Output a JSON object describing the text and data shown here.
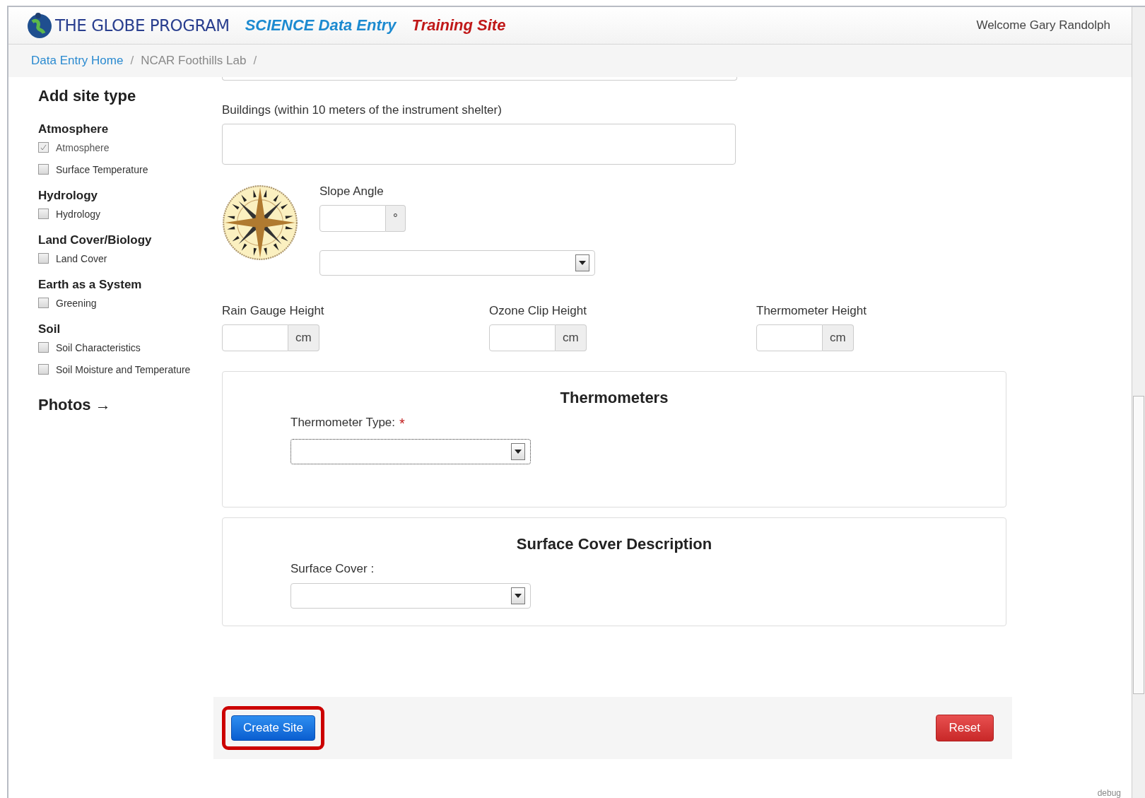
{
  "header": {
    "logo_text": "THE GLOBE PROGRAM",
    "app_title": "SCIENCE Data Entry",
    "site_label": "Training Site",
    "welcome": "Welcome Gary Randolph"
  },
  "breadcrumbs": [
    {
      "label": "Data Entry Home",
      "kind": "link",
      "separator": "/"
    },
    {
      "label": "NCAR Foothills Lab",
      "kind": "current",
      "separator": "/"
    }
  ],
  "sidebar": {
    "title": "Add site type",
    "groups": [
      {
        "heading": "Atmosphere",
        "items": [
          {
            "label": "Atmosphere",
            "checked": true,
            "disabled": true
          },
          {
            "label": "Surface Temperature",
            "checked": false,
            "disabled": false
          }
        ]
      },
      {
        "heading": "Hydrology",
        "items": [
          {
            "label": "Hydrology",
            "checked": false,
            "disabled": false
          }
        ]
      },
      {
        "heading": "Land Cover/Biology",
        "items": [
          {
            "label": "Land Cover",
            "checked": false,
            "disabled": false
          }
        ]
      },
      {
        "heading": "Earth as a System",
        "items": [
          {
            "label": "Greening",
            "checked": false,
            "disabled": false
          }
        ]
      },
      {
        "heading": "Soil",
        "items": [
          {
            "label": "Soil Characteristics",
            "checked": false,
            "disabled": false
          },
          {
            "label": "Soil Moisture and Temperature",
            "checked": false,
            "disabled": false
          }
        ]
      }
    ],
    "photos_link": "Photos →"
  },
  "form": {
    "buildings_label": "Buildings (within 10 meters of the instrument shelter)",
    "slope_label": "Slope Angle",
    "slope_unit": "°",
    "heights": [
      {
        "label": "Rain Gauge Height",
        "unit": "cm"
      },
      {
        "label": "Ozone Clip Height",
        "unit": "cm"
      },
      {
        "label": "Thermometer Height",
        "unit": "cm"
      }
    ],
    "panels": [
      {
        "title": "Thermometers",
        "field_label": "Thermometer Type:",
        "required_mark": "*"
      },
      {
        "title": "Surface Cover Description",
        "field_label": "Surface Cover :"
      }
    ]
  },
  "actions": {
    "create": "Create Site",
    "reset": "Reset",
    "create_highlighted": true
  },
  "debug": "debug"
}
